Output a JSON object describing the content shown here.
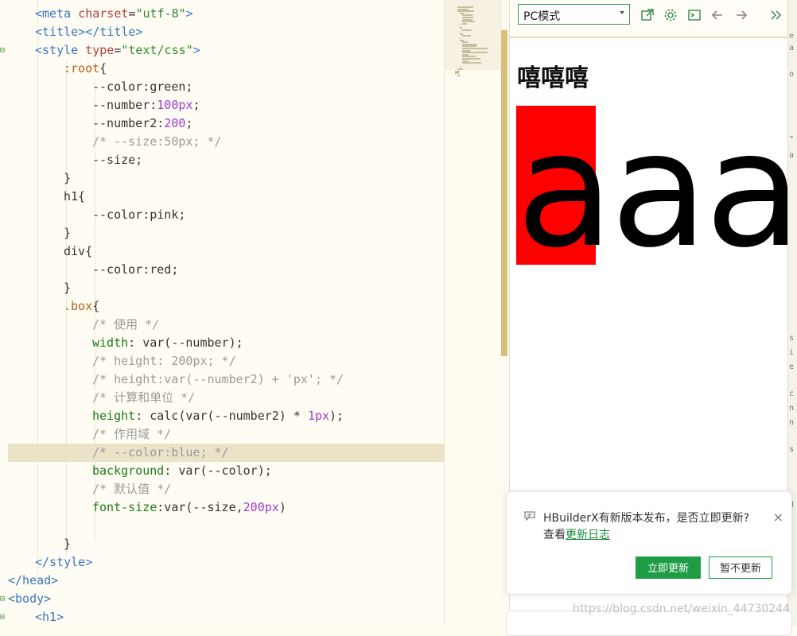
{
  "editor": {
    "lines": [
      [
        [
          "tag",
          "<meta "
        ],
        [
          "attr",
          "charset"
        ],
        [
          "plain",
          "="
        ],
        [
          "str",
          "\"utf-8\""
        ],
        [
          "tag",
          ">"
        ]
      ],
      [
        [
          "tag",
          "<title></title>"
        ]
      ],
      [
        [
          "tag",
          "<style "
        ],
        [
          "attr",
          "type"
        ],
        [
          "plain",
          "="
        ],
        [
          "str",
          "\"text/css\""
        ],
        [
          "tag",
          ">"
        ]
      ],
      [
        [
          "sel",
          ":root"
        ],
        [
          "plain",
          "{"
        ]
      ],
      [
        [
          "plain",
          "--color:green;"
        ]
      ],
      [
        [
          "plain",
          "--number:"
        ],
        [
          "num",
          "100px"
        ],
        [
          "plain",
          ";"
        ]
      ],
      [
        [
          "plain",
          "--number2:"
        ],
        [
          "num",
          "200"
        ],
        [
          "plain",
          ";"
        ]
      ],
      [
        [
          "com",
          "/* --size:50px; */"
        ]
      ],
      [
        [
          "plain",
          "--size;"
        ]
      ],
      [
        [
          "plain",
          "}"
        ]
      ],
      [
        [
          "plain",
          "h1{"
        ]
      ],
      [
        [
          "plain",
          "--color:pink;"
        ]
      ],
      [
        [
          "plain",
          "}"
        ]
      ],
      [
        [
          "plain",
          "div{"
        ]
      ],
      [
        [
          "plain",
          "--color:red;"
        ]
      ],
      [
        [
          "plain",
          "}"
        ]
      ],
      [
        [
          "sel",
          ".box"
        ],
        [
          "plain",
          "{"
        ]
      ],
      [
        [
          "com",
          "/* 使用 */"
        ]
      ],
      [
        [
          "prop",
          "width"
        ],
        [
          "plain",
          ": var(--number);"
        ]
      ],
      [
        [
          "com",
          "/* height: 200px; */"
        ]
      ],
      [
        [
          "com",
          "/* height:var(--number2) + 'px'; */"
        ]
      ],
      [
        [
          "com",
          "/* 计算和单位 */"
        ]
      ],
      [
        [
          "prop",
          "height"
        ],
        [
          "plain",
          ": calc(var(--number2) * "
        ],
        [
          "num",
          "1px"
        ],
        [
          "plain",
          ");"
        ]
      ],
      [
        [
          "com",
          "/* 作用域 */"
        ]
      ],
      [
        [
          "com",
          "/* --color:blue; */"
        ]
      ],
      [
        [
          "prop",
          "background"
        ],
        [
          "plain",
          ": var(--color);"
        ]
      ],
      [
        [
          "com",
          "/* 默认值 */"
        ]
      ],
      [
        [
          "prop",
          "font-size"
        ],
        [
          "plain",
          ":var(--size,"
        ],
        [
          "num",
          "200px"
        ],
        [
          "plain",
          ")"
        ]
      ],
      [
        [
          "plain",
          ""
        ]
      ],
      [
        [
          "plain",
          "}"
        ]
      ],
      [
        [
          "tag",
          "</style>"
        ]
      ],
      [
        [
          "tag",
          "</head>"
        ]
      ],
      [
        [
          "tag",
          "<body>"
        ]
      ],
      [
        [
          "tag",
          "<h1>"
        ]
      ]
    ]
  },
  "preview": {
    "mode_select": "PC模式",
    "h1_text": "嘻嘻嘻",
    "box_text": "aaaa",
    "box_color": "#ff0000"
  },
  "notification": {
    "message": "HBuilderX有新版本发布，是否立即更新?",
    "view_prefix": "查看",
    "changelog_link": "更新日志",
    "update_button": "立即更新",
    "later_button": "暂不更新",
    "close_glyph": "×"
  },
  "watermark": "https://blog.csdn.net/weixin_44730244",
  "colors": {
    "accent": "#1f9d45",
    "highlight_line": "#eae3c8",
    "scrollbar": "#d8c07a"
  }
}
